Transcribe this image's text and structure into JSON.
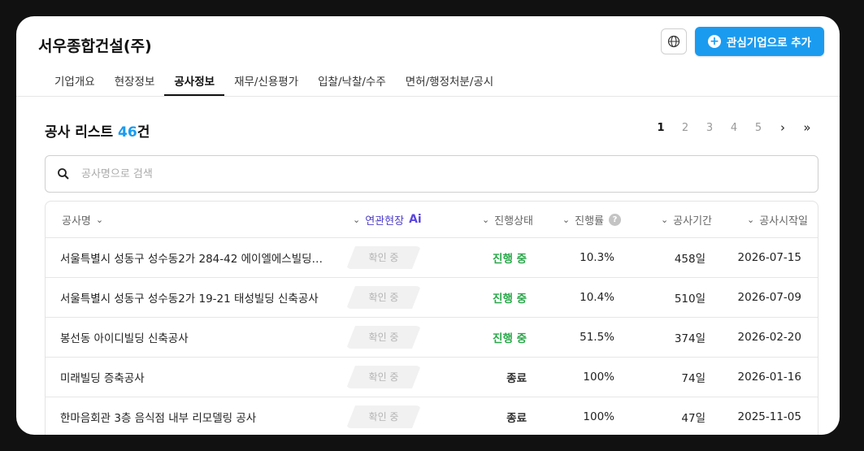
{
  "company": {
    "name": "서우종합건설(주)"
  },
  "header": {
    "add_label": "관심기업으로 추가"
  },
  "tabs": [
    {
      "label": "기업개요"
    },
    {
      "label": "현장정보"
    },
    {
      "label": "공사정보",
      "active": true
    },
    {
      "label": "재무/신용평가"
    },
    {
      "label": "입찰/낙찰/수주"
    },
    {
      "label": "면허/행정처분/공시"
    }
  ],
  "list": {
    "title": "공사 리스트",
    "count": "46",
    "unit": "건"
  },
  "pager": {
    "pages": [
      "1",
      "2",
      "3",
      "4",
      "5"
    ],
    "current": "1"
  },
  "search": {
    "placeholder": "공사명으로 검색"
  },
  "table": {
    "headers": {
      "name": "공사명",
      "site": "연관현장",
      "site_ai": "Ai",
      "status": "진행상태",
      "rate": "진행률",
      "days": "공사기간",
      "date": "공사시작일"
    },
    "rows": [
      {
        "name": "서울특별시 성동구 성수동2가 284-42 에이엘에스빌딩…",
        "site": "확인 중",
        "status": "진행 중",
        "rate": "10.3%",
        "days": "458일",
        "date": "2026-07-15"
      },
      {
        "name": "서울특별시 성동구 성수동2가 19-21 태성빌딩 신축공사",
        "site": "확인 중",
        "status": "진행 중",
        "rate": "10.4%",
        "days": "510일",
        "date": "2026-07-09"
      },
      {
        "name": "봉선동 아이디빌딩 신축공사",
        "site": "확인 중",
        "status": "진행 중",
        "rate": "51.5%",
        "days": "374일",
        "date": "2026-02-20"
      },
      {
        "name": "미래빌딩 증축공사",
        "site": "확인 중",
        "status": "종료",
        "rate": "100%",
        "days": "74일",
        "date": "2026-01-16"
      },
      {
        "name": "한마음회관 3층 음식점 내부 리모델링 공사",
        "site": "확인 중",
        "status": "종료",
        "rate": "100%",
        "days": "47일",
        "date": "2025-11-05"
      }
    ]
  },
  "colors": {
    "accent": "#1a9bf0",
    "in_progress": "#2aa84a",
    "ai": "#5a46e0"
  }
}
